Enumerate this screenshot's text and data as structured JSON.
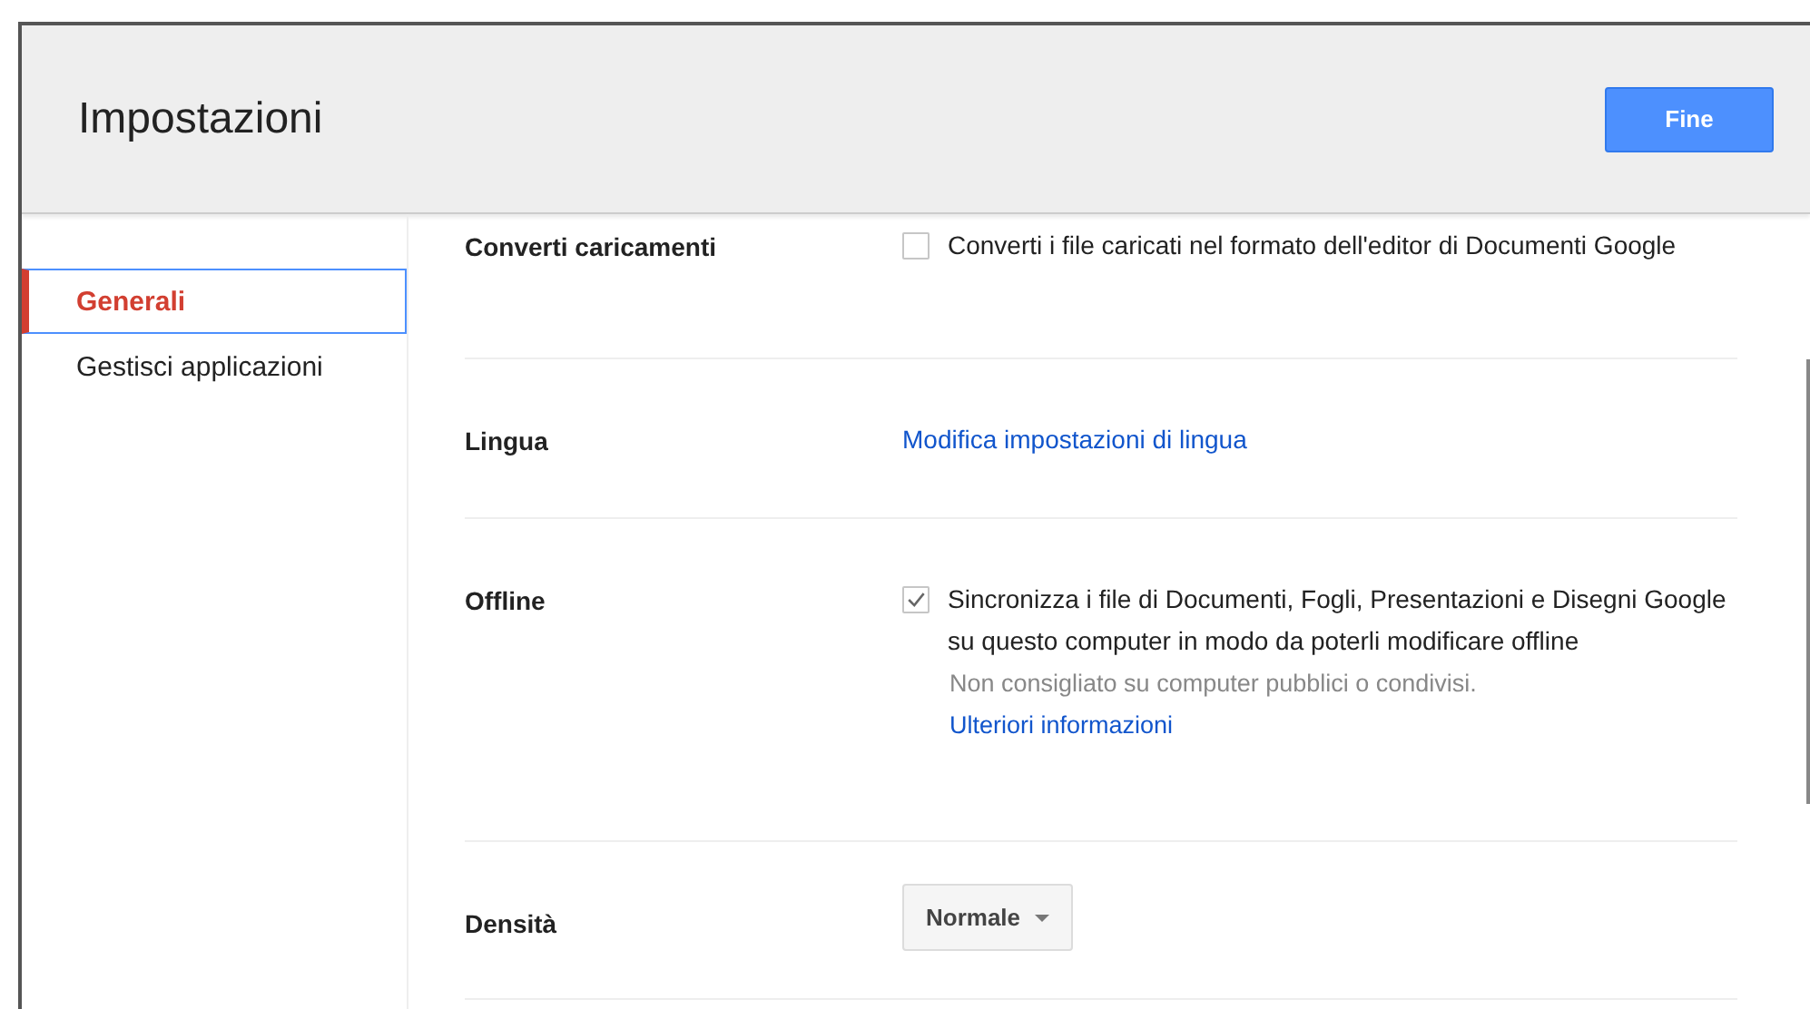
{
  "header": {
    "title": "Impostazioni",
    "done_button": "Fine"
  },
  "sidebar": {
    "items": [
      {
        "label": "Generali",
        "selected": true
      },
      {
        "label": "Gestisci applicazioni",
        "selected": false
      }
    ]
  },
  "settings": [
    {
      "kind": "checkbox",
      "label": "Converti caricamenti",
      "text": "Converti i file caricati nel formato dell'editor di Documenti Google",
      "checked": false
    },
    {
      "kind": "link",
      "label": "Lingua",
      "link": "Modifica impostazioni di lingua"
    },
    {
      "kind": "checkbox",
      "label": "Offline",
      "text": "Sincronizza i file di Documenti, Fogli, Presentazioni e Disegni Google su questo computer in modo da poterli modificare offline",
      "checked": true,
      "note": "Non consigliato su computer pubblici o condivisi.",
      "link": "Ulteriori informazioni"
    },
    {
      "kind": "dropdown",
      "label": "Densità",
      "value": "Normale"
    }
  ]
}
